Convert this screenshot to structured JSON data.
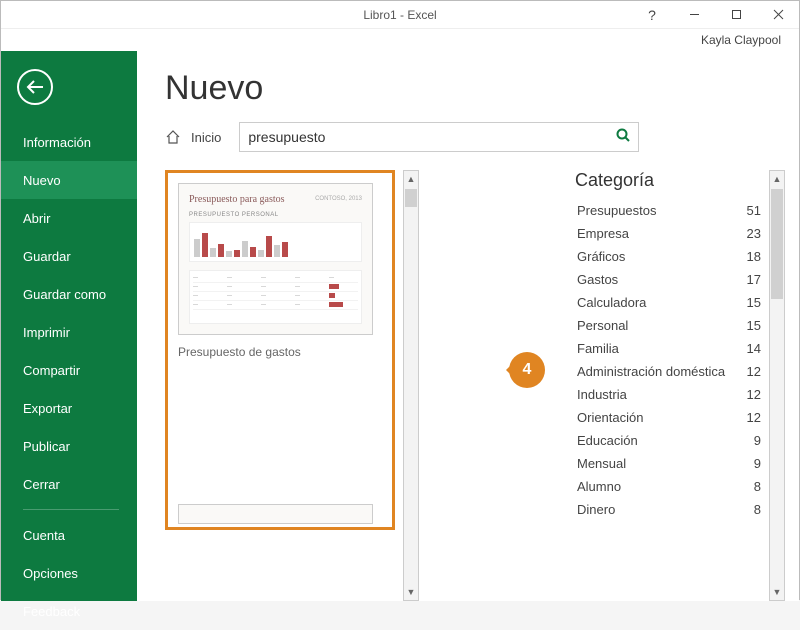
{
  "titlebar": {
    "title": "Libro1 - Excel",
    "help": "?"
  },
  "user": {
    "name": "Kayla Claypool"
  },
  "sidebar": {
    "items": [
      {
        "label": "Información"
      },
      {
        "label": "Nuevo",
        "active": true
      },
      {
        "label": "Abrir"
      },
      {
        "label": "Guardar"
      },
      {
        "label": "Guardar como"
      },
      {
        "label": "Imprimir"
      },
      {
        "label": "Compartir"
      },
      {
        "label": "Exportar"
      },
      {
        "label": "Publicar"
      },
      {
        "label": "Cerrar"
      }
    ],
    "footer": [
      {
        "label": "Cuenta"
      },
      {
        "label": "Opciones"
      },
      {
        "label": "Feedback"
      }
    ]
  },
  "page": {
    "heading": "Nuevo",
    "home_label": "Inicio",
    "search_value": "presupuesto"
  },
  "template": {
    "card_title": "Presupuesto para gastos",
    "card_brand": "CONTOSO, 2013",
    "card_sub": "PRESUPUESTO PERSONAL",
    "name": "Presupuesto de gastos"
  },
  "callout": {
    "number": "4"
  },
  "categories": {
    "heading": "Categoría",
    "items": [
      {
        "label": "Presupuestos",
        "count": "51"
      },
      {
        "label": "Empresa",
        "count": "23"
      },
      {
        "label": "Gráficos",
        "count": "18"
      },
      {
        "label": "Gastos",
        "count": "17"
      },
      {
        "label": "Calculadora",
        "count": "15"
      },
      {
        "label": "Personal",
        "count": "15"
      },
      {
        "label": "Familia",
        "count": "14"
      },
      {
        "label": "Administración doméstica",
        "count": "12"
      },
      {
        "label": "Industria",
        "count": "12"
      },
      {
        "label": "Orientación",
        "count": "12"
      },
      {
        "label": "Educación",
        "count": "9"
      },
      {
        "label": "Mensual",
        "count": "9"
      },
      {
        "label": "Alumno",
        "count": "8"
      },
      {
        "label": "Dinero",
        "count": "8"
      }
    ]
  }
}
